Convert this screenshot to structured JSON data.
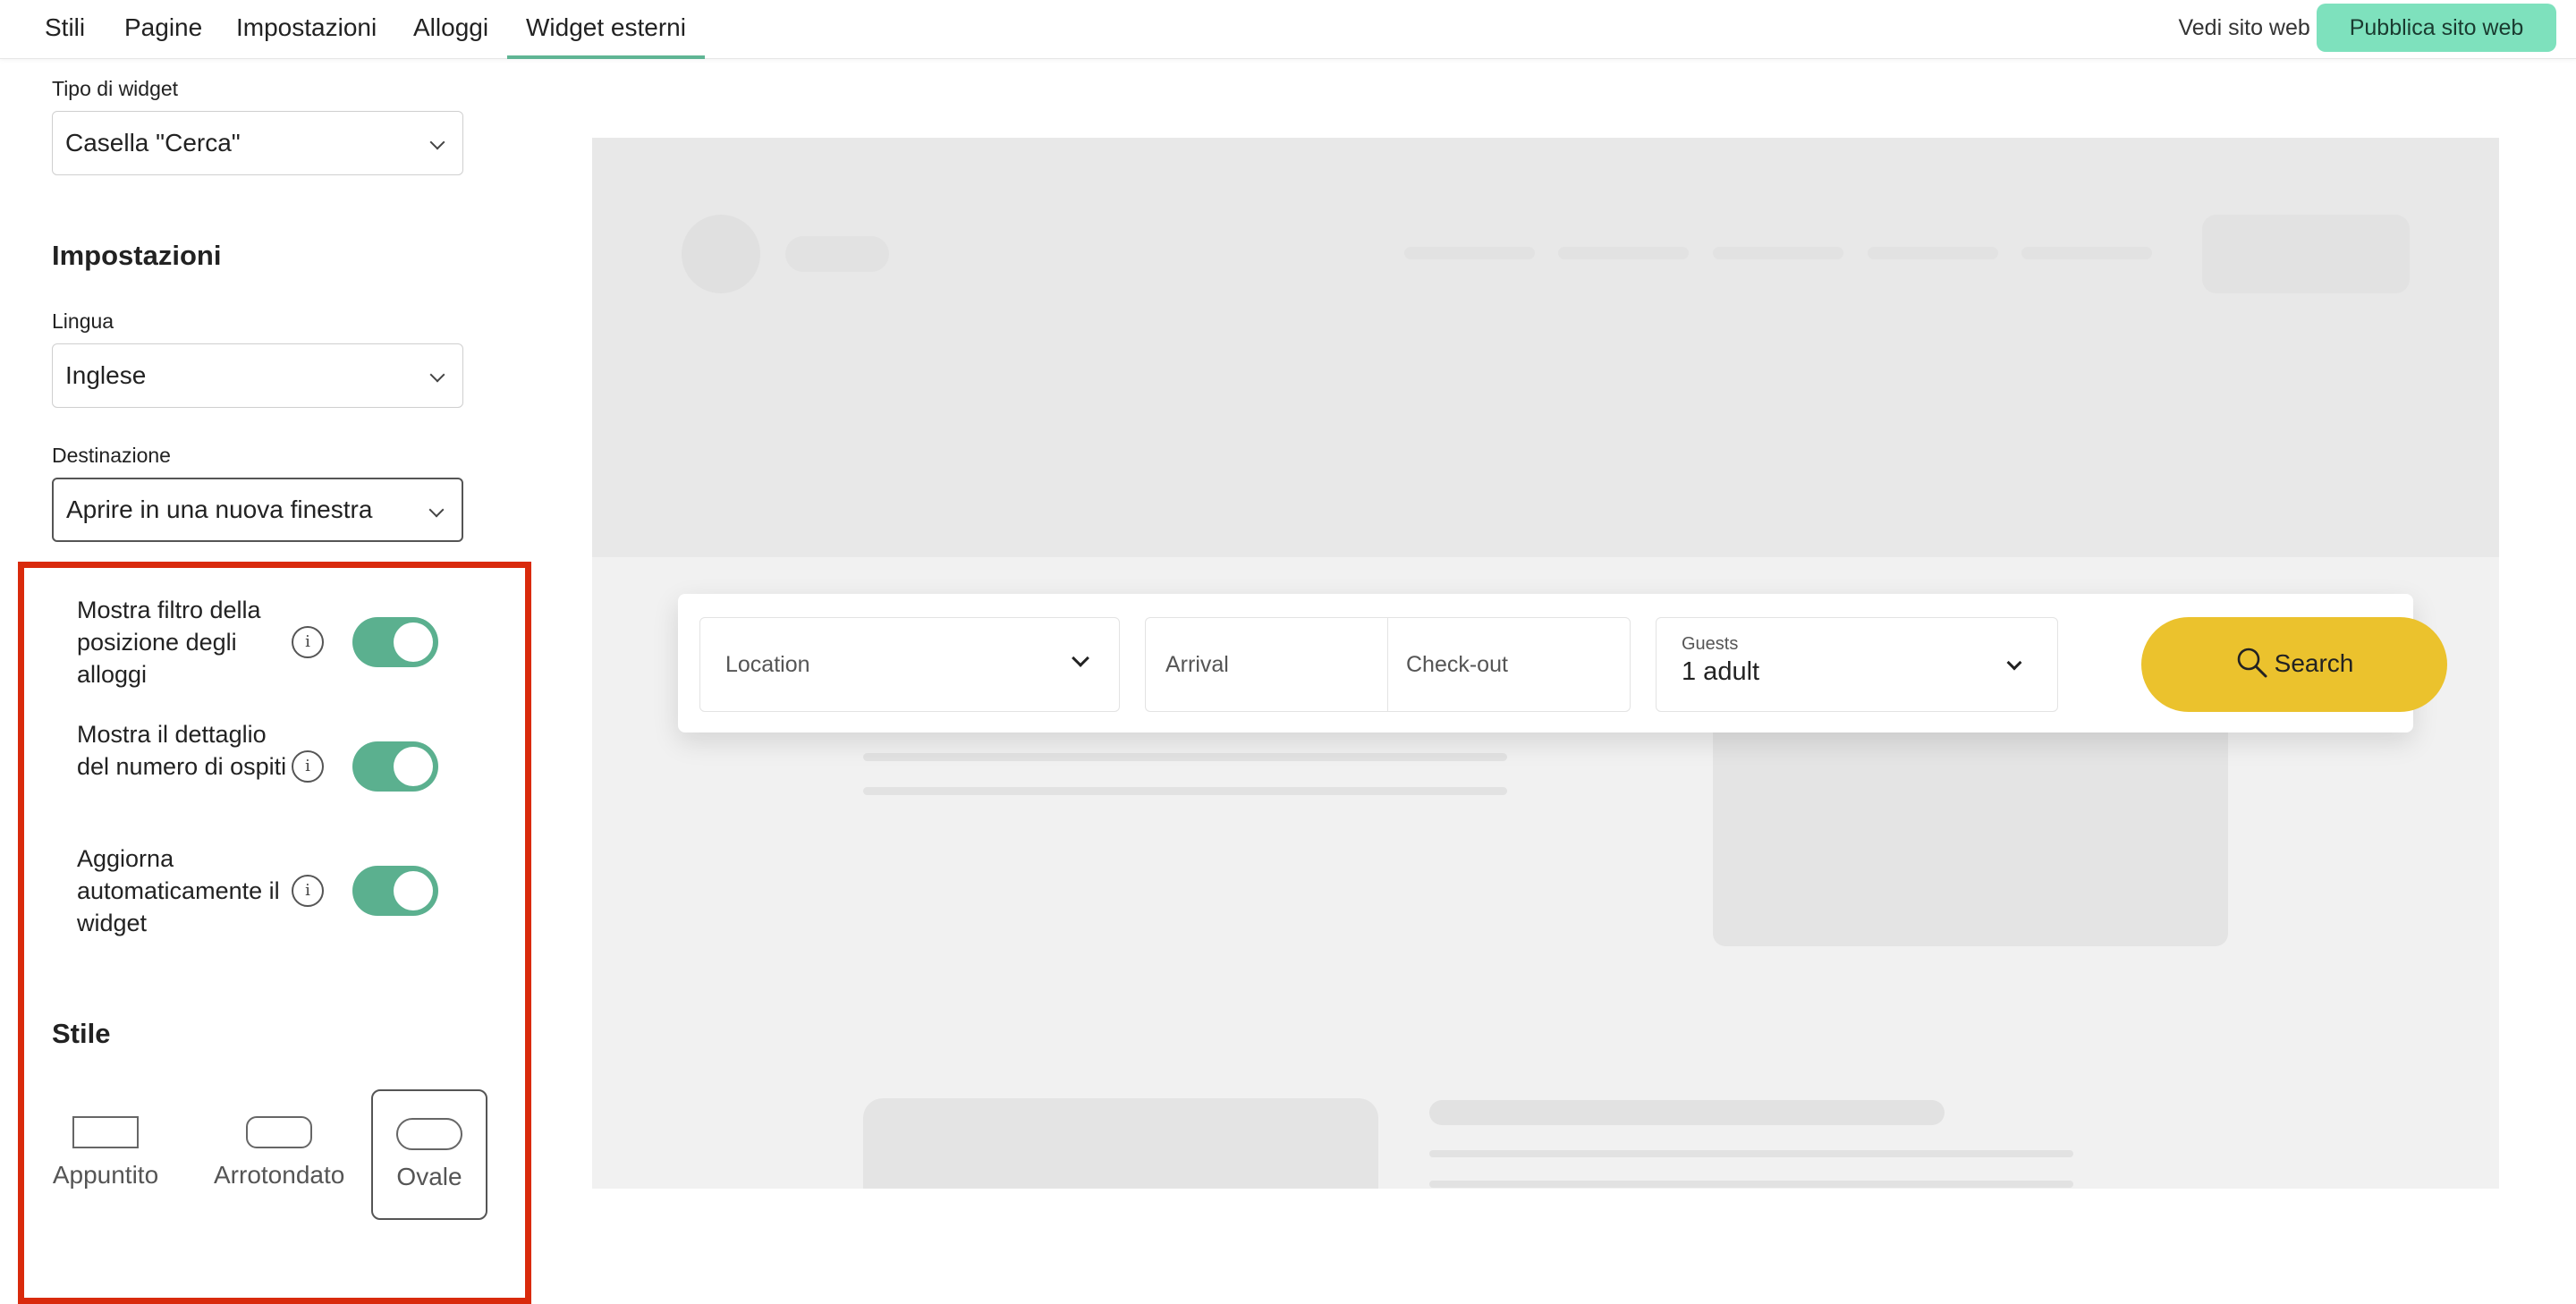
{
  "nav": {
    "tabs": [
      {
        "label": "Stili"
      },
      {
        "label": "Pagine"
      },
      {
        "label": "Impostazioni"
      },
      {
        "label": "Alloggi"
      },
      {
        "label": "Widget esterni",
        "active": true
      }
    ],
    "view_site": "Vedi sito web",
    "publish": "Pubblica sito web",
    "accent_color": "#5fb594",
    "publish_color": "#7ee1bd"
  },
  "sidebar": {
    "widget_type_label": "Tipo di widget",
    "widget_type_value": "Casella \"Cerca\"",
    "settings_heading": "Impostazioni",
    "language_label": "Lingua",
    "language_value": "Inglese",
    "destination_label": "Destinazione",
    "destination_value": "Aprire in una nuova finestra",
    "toggles": [
      {
        "label": "Mostra filtro della posizione degli alloggi",
        "on": true
      },
      {
        "label": "Mostra il dettaglio del numero di ospiti",
        "on": true
      },
      {
        "label": "Aggiorna automaticamente il widget",
        "on": true
      }
    ],
    "info_glyph": "i",
    "style_heading": "Stile",
    "styles": [
      {
        "label": "Appuntito",
        "icon": "sharp-rectangle-icon"
      },
      {
        "label": "Arrotondato",
        "icon": "rounded-rectangle-icon"
      },
      {
        "label": "Ovale",
        "icon": "oval-icon",
        "selected": true
      }
    ],
    "toggle_color": "#5bb08f",
    "highlight_color": "#d92a0c"
  },
  "preview": {
    "location_placeholder": "Location",
    "arrival_placeholder": "Arrival",
    "checkout_placeholder": "Check-out",
    "guests_label": "Guests",
    "guests_value": "1 adult",
    "search_label": "Search",
    "search_color": "#ebc22d"
  }
}
